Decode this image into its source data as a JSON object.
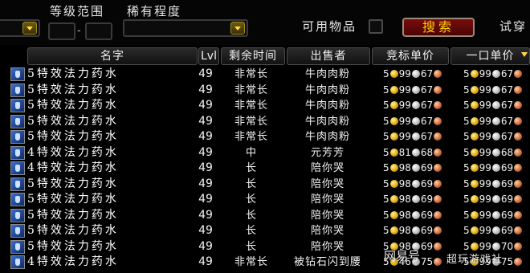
{
  "filters": {
    "level_range_label": "等级范围",
    "level_sep": "-",
    "rarity_label": "稀有程度",
    "usable_label": "可用物品",
    "search_button": "搜索",
    "try_on_label": "试穿"
  },
  "columns": {
    "name": "名字",
    "level": "Lvl",
    "time_left": "剩余时间",
    "seller": "出售者",
    "bid_price": "竞标单价",
    "buyout_price": "一口单价"
  },
  "rows": [
    {
      "name": "5特效法力药水",
      "level": "49",
      "time_left": "非常长",
      "seller": "牛肉肉粉",
      "bid": [
        "5",
        "99",
        "67"
      ],
      "buyout": [
        "5",
        "99",
        "67"
      ]
    },
    {
      "name": "5特效法力药水",
      "level": "49",
      "time_left": "非常长",
      "seller": "牛肉肉粉",
      "bid": [
        "5",
        "99",
        "67"
      ],
      "buyout": [
        "5",
        "99",
        "67"
      ]
    },
    {
      "name": "5特效法力药水",
      "level": "49",
      "time_left": "非常长",
      "seller": "牛肉肉粉",
      "bid": [
        "5",
        "99",
        "67"
      ],
      "buyout": [
        "5",
        "99",
        "67"
      ]
    },
    {
      "name": "5特效法力药水",
      "level": "49",
      "time_left": "非常长",
      "seller": "牛肉肉粉",
      "bid": [
        "5",
        "99",
        "67"
      ],
      "buyout": [
        "5",
        "99",
        "67"
      ]
    },
    {
      "name": "5特效法力药水",
      "level": "49",
      "time_left": "非常长",
      "seller": "牛肉肉粉",
      "bid": [
        "5",
        "99",
        "67"
      ],
      "buyout": [
        "5",
        "99",
        "67"
      ]
    },
    {
      "name": "4特效法力药水",
      "level": "49",
      "time_left": "中",
      "seller": "元芳芳",
      "bid": [
        "5",
        "81",
        "68"
      ],
      "buyout": [
        "5",
        "99",
        "68"
      ]
    },
    {
      "name": "4特效法力药水",
      "level": "49",
      "time_left": "长",
      "seller": "陪你哭",
      "bid": [
        "5",
        "98",
        "69"
      ],
      "buyout": [
        "5",
        "99",
        "69"
      ]
    },
    {
      "name": "5特效法力药水",
      "level": "49",
      "time_left": "长",
      "seller": "陪你哭",
      "bid": [
        "5",
        "98",
        "69"
      ],
      "buyout": [
        "5",
        "99",
        "69"
      ]
    },
    {
      "name": "5特效法力药水",
      "level": "49",
      "time_left": "长",
      "seller": "陪你哭",
      "bid": [
        "5",
        "98",
        "69"
      ],
      "buyout": [
        "5",
        "99",
        "69"
      ]
    },
    {
      "name": "5特效法力药水",
      "level": "49",
      "time_left": "长",
      "seller": "陪你哭",
      "bid": [
        "5",
        "98",
        "69"
      ],
      "buyout": [
        "5",
        "99",
        "69"
      ]
    },
    {
      "name": "5特效法力药水",
      "level": "49",
      "time_left": "长",
      "seller": "陪你哭",
      "bid": [
        "5",
        "98",
        "69"
      ],
      "buyout": [
        "5",
        "99",
        "69"
      ]
    },
    {
      "name": "5特效法力药水",
      "level": "49",
      "time_left": "长",
      "seller": "陪你哭",
      "bid": [
        "5",
        "98",
        "69"
      ],
      "buyout": [
        "5",
        "99",
        "70"
      ]
    },
    {
      "name": "4特效法力药水",
      "level": "49",
      "time_left": "非常长",
      "seller": "被钻石闪到腰",
      "bid": [
        "5",
        "46",
        "75"
      ],
      "buyout": [
        "5",
        "99",
        "75"
      ]
    }
  ],
  "watermark": {
    "brand": "网易号",
    "author": "超玩游戏社"
  },
  "colors": {
    "search_button_bg": "#6a0808",
    "search_button_text": "#ffcc00",
    "dropdown_arrow": "#ffd84a",
    "item_icon": "#3c6ccf"
  },
  "icons": {
    "item": "blue-potion-icon",
    "dropdown": "chevron-down-icon",
    "sort": "sort-down-icon",
    "coins": [
      "gold-coin-icon",
      "silver-coin-icon",
      "copper-coin-icon"
    ]
  }
}
